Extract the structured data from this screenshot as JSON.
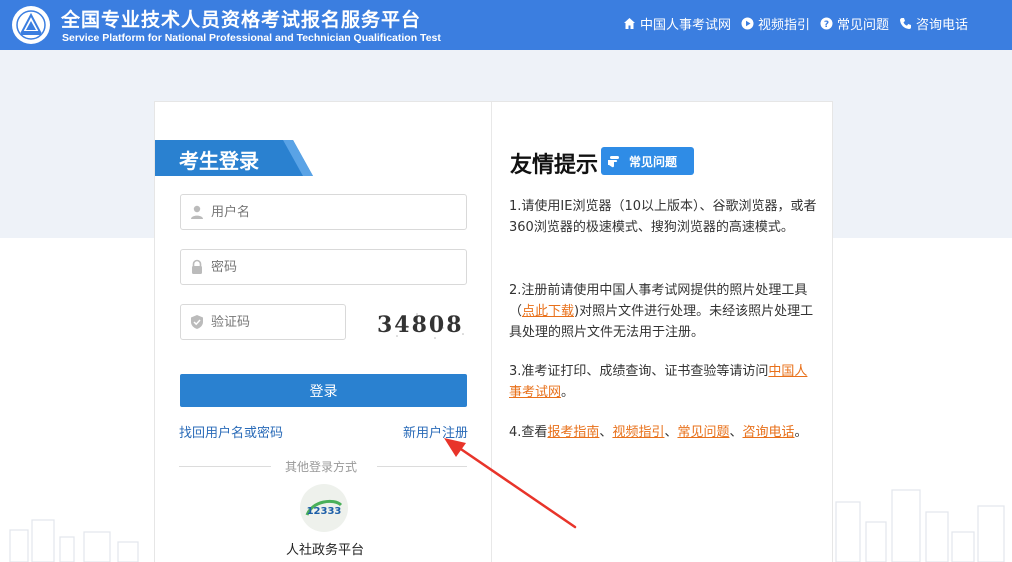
{
  "header": {
    "title_cn": "全国专业技术人员资格考试报名服务平台",
    "title_en": "Service Platform for National Professional and Technician Qualification Test",
    "nav": [
      {
        "label": "中国人事考试网",
        "icon": "home-icon"
      },
      {
        "label": "视频指引",
        "icon": "play-icon"
      },
      {
        "label": "常见问题",
        "icon": "question-icon"
      },
      {
        "label": "咨询电话",
        "icon": "phone-icon"
      }
    ]
  },
  "login": {
    "tab_title": "考生登录",
    "username_placeholder": "用户名",
    "password_placeholder": "密码",
    "captcha_placeholder": "验证码",
    "captcha_text": "34808",
    "login_button": "登录",
    "forgot_link": "找回用户名或密码",
    "register_link": "新用户注册",
    "other_login_label": "其他登录方式",
    "gov_platform_label": "人社政务平台",
    "gov_icon_text": "12333"
  },
  "tips": {
    "title": "友情提示",
    "faq_badge": "常见问题",
    "items": {
      "t1": "1.请使用IE浏览器（10以上版本）、谷歌浏览器，或者360浏览器的极速模式、搜狗浏览器的高速模式。",
      "t2_before": "2.注册前请使用中国人事考试网提供的照片处理工具（",
      "t2_link": "点此下载",
      "t2_after": ")对照片文件进行处理。未经该照片处理工具处理的照片文件无法用于注册。",
      "t3_before": "3.准考证打印、成绩查询、证书查验等请访问",
      "t3_link": "中国人事考试网",
      "t3_after": "。",
      "t4_before": "4.查看",
      "t4_link1": "报考指南",
      "t4_sep1": "、",
      "t4_link2": "视频指引",
      "t4_sep2": "、",
      "t4_link3": "常见问题",
      "t4_sep3": "、",
      "t4_link4": "咨询电话",
      "t4_after": "。"
    }
  },
  "colors": {
    "header_bg": "#3b7ee0",
    "accent_blue": "#2a81d0",
    "link_orange": "#e8701a",
    "arrow_red": "#e8342a"
  }
}
